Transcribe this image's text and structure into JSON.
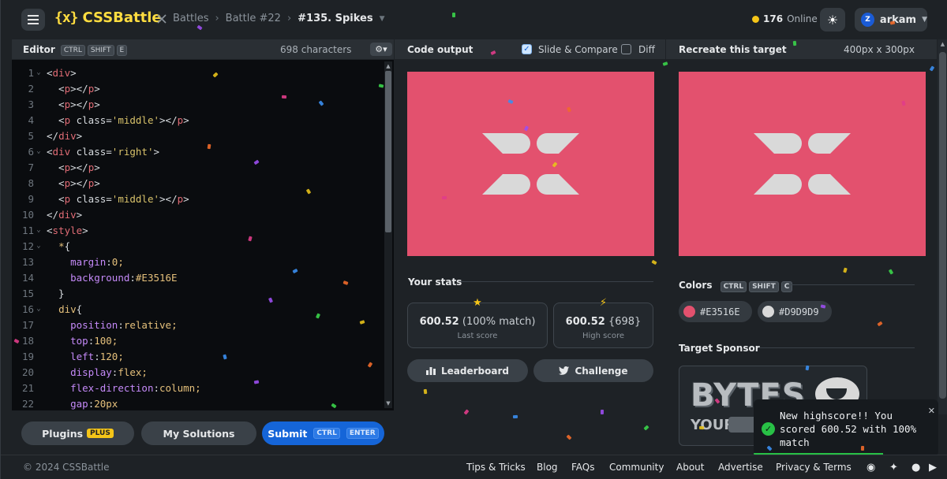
{
  "header": {
    "logo_mark": "{x}",
    "logo_text": "CSSBattle",
    "breadcrumbs": [
      "Battles",
      "Battle #22"
    ],
    "current": "#135. Spikes",
    "online_count": "176",
    "online_label": "Online",
    "user": {
      "initial": "Z",
      "name": "arkam"
    }
  },
  "editor": {
    "title": "Editor",
    "shortcut": [
      "CTRL",
      "SHIFT",
      "E"
    ],
    "char_count": "698 characters",
    "lines": [
      "<div>",
      "  <p></p>",
      "  <p></p>",
      "  <p class='middle'></p>",
      "</div>",
      "<div class='right'>",
      "  <p></p>",
      "  <p></p>",
      "  <p class='middle'></p>",
      "</div>",
      "<style>",
      "  *{",
      "    margin:0;",
      "    background:#E3516E",
      "  }",
      "  div{",
      "    position:relative;",
      "    top:100;",
      "    left:120;",
      "    display:flex;",
      "    flex-direction:column;",
      "    gap:20px"
    ],
    "foot": {
      "plugins_label": "Plugins",
      "plugins_badge": "PLUS",
      "solutions_label": "My Solutions",
      "submit_label": "Submit",
      "submit_keys": [
        "CTRL",
        "ENTER"
      ]
    }
  },
  "output": {
    "title": "Code output",
    "slide_compare_label": "Slide & Compare",
    "slide_compare_checked": true,
    "diff_label": "Diff",
    "diff_checked": false,
    "stats_title": "Your stats",
    "last_score": {
      "score": "600.52",
      "detail": "(100% match)",
      "label": "Last score"
    },
    "high_score": {
      "score": "600.52",
      "detail": "{698}",
      "label": "High score"
    },
    "leaderboard_label": "Leaderboard",
    "challenge_label": "Challenge"
  },
  "target": {
    "title": "Recreate this target",
    "size": "400px x 300px",
    "colors_title": "Colors",
    "colors_shortcut": [
      "CTRL",
      "SHIFT",
      "C"
    ],
    "colors": [
      {
        "hex": "#E3516E",
        "swatch": "#e3516e"
      },
      {
        "hex": "#D9D9D9",
        "swatch": "#d9d9d9"
      }
    ],
    "sponsor_title": "Target Sponsor",
    "sponsor_word": "BYTES",
    "sponsor_sub": "YOUR"
  },
  "toast": {
    "message": "New highscore!! You scored 600.52 with 100% match",
    "progress": 0.7
  },
  "footer": {
    "copyright": "© 2024 CSSBattle",
    "links": [
      "Tips & Tricks",
      "Blog",
      "FAQs",
      "Community",
      "About",
      "Advertise",
      "Privacy & Terms"
    ]
  },
  "colors": {
    "accent": "#1565d8",
    "brand": "#ffdd40",
    "target_bg": "#E3516E",
    "shape": "#D9D9D9"
  }
}
